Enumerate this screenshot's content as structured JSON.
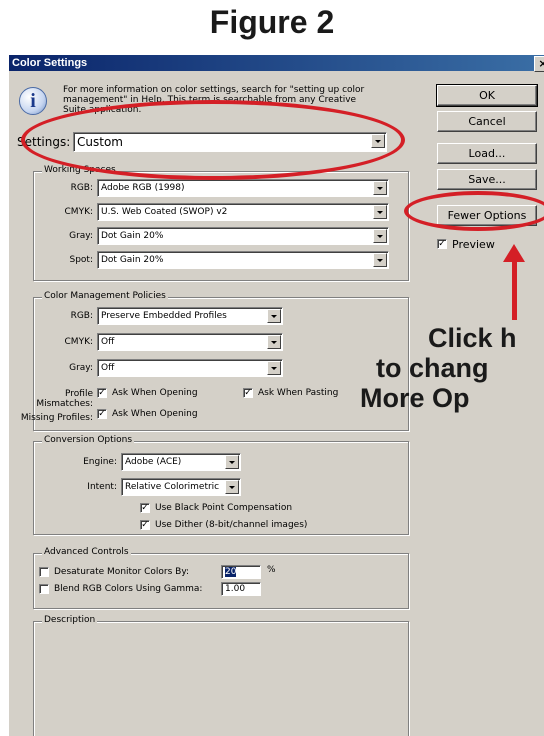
{
  "figure_title": "Figure 2",
  "window": {
    "title": "Color Settings",
    "close": "×",
    "info_text": "For more information on color settings, search for \"setting up color management\" in Help. This term is searchable from any Creative Suite application."
  },
  "settings": {
    "label": "Settings:",
    "value": "Custom"
  },
  "buttons": {
    "ok": "OK",
    "cancel": "Cancel",
    "load": "Load...",
    "save": "Save...",
    "fewer_options": "Fewer Options"
  },
  "preview": {
    "label": "Preview",
    "checked": true
  },
  "working_spaces": {
    "legend": "Working Spaces",
    "rgb": {
      "label": "RGB:",
      "value": "Adobe RGB (1998)"
    },
    "cmyk": {
      "label": "CMYK:",
      "value": "U.S. Web Coated (SWOP) v2"
    },
    "gray": {
      "label": "Gray:",
      "value": "Dot Gain 20%"
    },
    "spot": {
      "label": "Spot:",
      "value": "Dot Gain 20%"
    }
  },
  "policies": {
    "legend": "Color Management Policies",
    "rgb": {
      "label": "RGB:",
      "value": "Preserve Embedded Profiles"
    },
    "cmyk": {
      "label": "CMYK:",
      "value": "Off"
    },
    "gray": {
      "label": "Gray:",
      "value": "Off"
    },
    "profile_mismatches": {
      "label": "Profile Mismatches:",
      "ask_opening": "Ask When Opening",
      "ask_pasting": "Ask When Pasting"
    },
    "missing_profiles": {
      "label": "Missing Profiles:",
      "ask_opening": "Ask When Opening"
    }
  },
  "conversion": {
    "legend": "Conversion Options",
    "engine": {
      "label": "Engine:",
      "value": "Adobe (ACE)"
    },
    "intent": {
      "label": "Intent:",
      "value": "Relative Colorimetric"
    },
    "black_point": "Use Black Point Compensation",
    "dither": "Use Dither (8-bit/channel images)"
  },
  "advanced": {
    "legend": "Advanced Controls",
    "desaturate": {
      "label": "Desaturate Monitor Colors By:",
      "value": "20",
      "unit": "%"
    },
    "blend": {
      "label": "Blend RGB Colors Using Gamma:",
      "value": "1.00"
    }
  },
  "description": {
    "legend": "Description"
  },
  "annotation": {
    "line1": "Click h",
    "line2": "to chang",
    "line3": "More Op"
  },
  "colors": {
    "highlight": "#d41f26",
    "dialog": "#d4d0c8",
    "titlebar": "#0a246a"
  }
}
